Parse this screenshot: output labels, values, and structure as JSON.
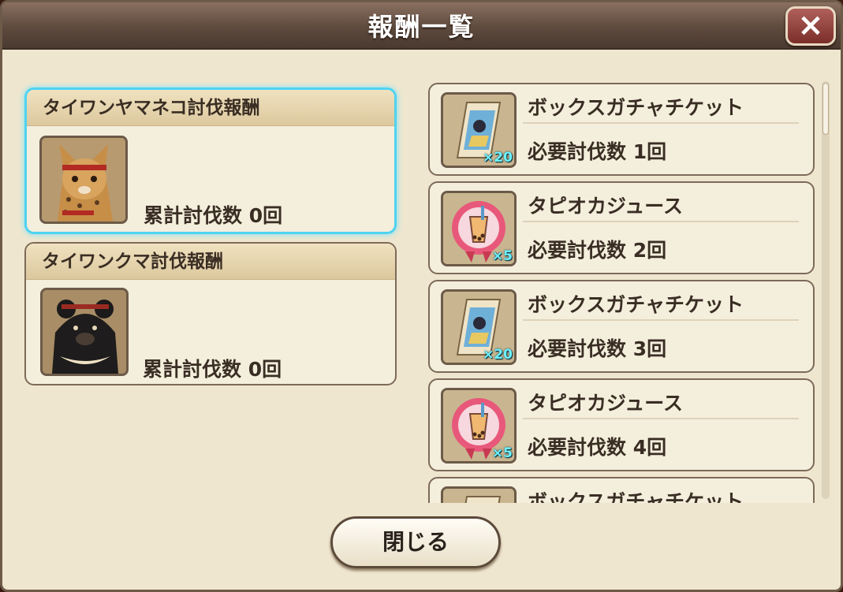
{
  "dialog": {
    "title": "報酬一覧",
    "close_icon": "×",
    "close_label": "閉じる"
  },
  "monsters": [
    {
      "name": "タイワンヤマネコ討伐報酬",
      "kill_count": "累計討伐数 0回",
      "icon": "leopard-cat-icon",
      "selected": true
    },
    {
      "name": "タイワンクマ討伐報酬",
      "kill_count": "累計討伐数 0回",
      "icon": "black-bear-icon",
      "selected": false
    }
  ],
  "rewards": [
    {
      "name": "ボックスガチャチケット",
      "qty": "×20",
      "required": "必要討伐数 1回",
      "icon": "gacha-ticket-icon"
    },
    {
      "name": "タピオカジュース",
      "qty": "×5",
      "required": "必要討伐数 2回",
      "icon": "tapioca-juice-icon"
    },
    {
      "name": "ボックスガチャチケット",
      "qty": "×20",
      "required": "必要討伐数 3回",
      "icon": "gacha-ticket-icon"
    },
    {
      "name": "タピオカジュース",
      "qty": "×5",
      "required": "必要討伐数 4回",
      "icon": "tapioca-juice-icon"
    },
    {
      "name": "ボックスガチャチケット",
      "qty": "",
      "required": "",
      "icon": "gacha-ticket-icon"
    }
  ],
  "colors": {
    "panel_bg": "#efe6cf",
    "titlebar": "#5e4a3e",
    "selected_outline": "#4fd3f0",
    "close_button": "#7a2e2a"
  }
}
